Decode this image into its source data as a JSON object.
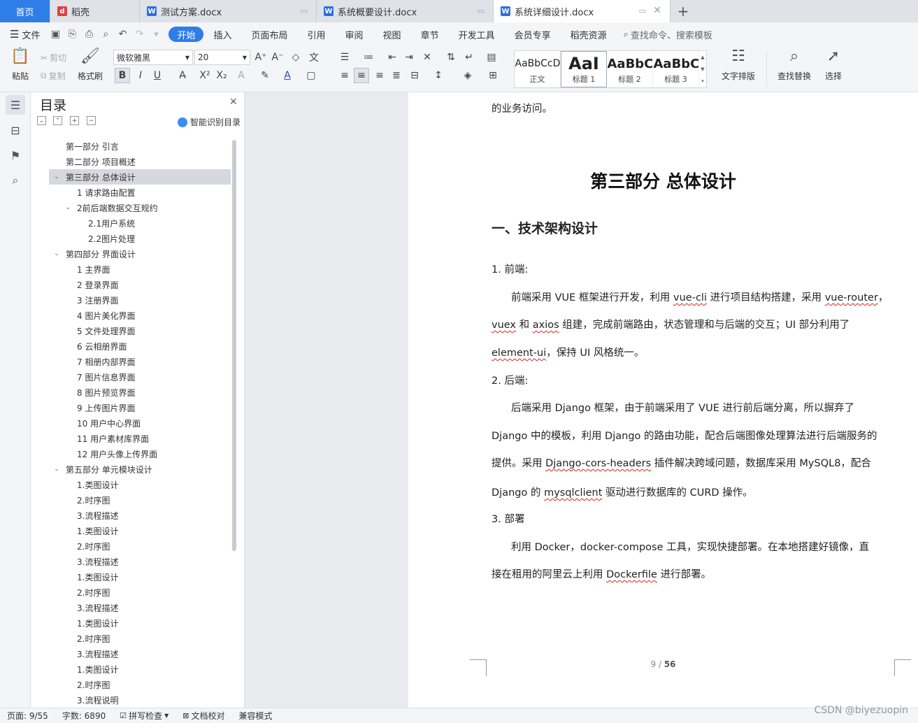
{
  "tabs": [
    {
      "label": "首页",
      "kind": "home"
    },
    {
      "label": "稻壳",
      "kind": "docer"
    },
    {
      "label": "测试方案.docx",
      "kind": "file"
    },
    {
      "label": "系统概要设计.docx",
      "kind": "file"
    },
    {
      "label": "系统详细设计.docx",
      "kind": "active"
    }
  ],
  "menu": {
    "file": "文件",
    "items": [
      "开始",
      "插入",
      "页面布局",
      "引用",
      "审阅",
      "视图",
      "章节",
      "开发工具",
      "会员专享",
      "稻壳资源"
    ],
    "search": "查找命令、搜索模板"
  },
  "ribbon": {
    "paste": "粘贴",
    "cut": "剪切",
    "copy": "复制",
    "format_painter": "格式刷",
    "font_name": "微软雅黑",
    "font_size": "20",
    "styles": [
      {
        "preview": "AaBbCcDd",
        "label": "正文"
      },
      {
        "preview": "AaI",
        "label": "标题 1"
      },
      {
        "preview": "AaBbC",
        "label": "标题 2"
      },
      {
        "preview": "AaBbC",
        "label": "标题 3"
      }
    ],
    "text_layout": "文字排版",
    "find_replace": "查找替换",
    "select": "选择"
  },
  "toc": {
    "title": "目录",
    "smart": "智能识别目录",
    "items": [
      {
        "text": "第一部分 引言",
        "level": 1,
        "arrow": ""
      },
      {
        "text": "第二部分 项目概述",
        "level": 1,
        "arrow": ""
      },
      {
        "text": "第三部分 总体设计",
        "level": 1,
        "arrow": "v",
        "selected": true
      },
      {
        "text": "1 请求路由配置",
        "level": 2,
        "arrow": ""
      },
      {
        "text": "2前后端数据交互规约",
        "level": 2,
        "arrow": "v"
      },
      {
        "text": "2.1用户系统",
        "level": 3,
        "arrow": ""
      },
      {
        "text": "2.2图片处理",
        "level": 3,
        "arrow": ""
      },
      {
        "text": "第四部分 界面设计",
        "level": 1,
        "arrow": "v"
      },
      {
        "text": "1 主界面",
        "level": 2,
        "arrow": ""
      },
      {
        "text": "2 登录界面",
        "level": 2,
        "arrow": ""
      },
      {
        "text": "3 注册界面",
        "level": 2,
        "arrow": ""
      },
      {
        "text": "4 图片美化界面",
        "level": 2,
        "arrow": ""
      },
      {
        "text": "5 文件处理界面",
        "level": 2,
        "arrow": ""
      },
      {
        "text": "6 云相册界面",
        "level": 2,
        "arrow": ""
      },
      {
        "text": "7 相册内部界面",
        "level": 2,
        "arrow": ""
      },
      {
        "text": "7 图片信息界面",
        "level": 2,
        "arrow": ""
      },
      {
        "text": "8 图片预览界面",
        "level": 2,
        "arrow": ""
      },
      {
        "text": "9 上传图片界面",
        "level": 2,
        "arrow": ""
      },
      {
        "text": "10 用户中心界面",
        "level": 2,
        "arrow": ""
      },
      {
        "text": "11 用户素材库界面",
        "level": 2,
        "arrow": ""
      },
      {
        "text": "12 用户头像上传界面",
        "level": 2,
        "arrow": ""
      },
      {
        "text": "第五部分 单元模块设计",
        "level": 1,
        "arrow": "v"
      },
      {
        "text": "1.类图设计",
        "level": 2,
        "arrow": ""
      },
      {
        "text": "2.时序图",
        "level": 2,
        "arrow": ""
      },
      {
        "text": "3.流程描述",
        "level": 2,
        "arrow": ""
      },
      {
        "text": "1.类图设计",
        "level": 2,
        "arrow": ""
      },
      {
        "text": "2.时序图",
        "level": 2,
        "arrow": ""
      },
      {
        "text": "3.流程描述",
        "level": 2,
        "arrow": ""
      },
      {
        "text": "1.类图设计",
        "level": 2,
        "arrow": ""
      },
      {
        "text": "2.时序图",
        "level": 2,
        "arrow": ""
      },
      {
        "text": "3.流程描述",
        "level": 2,
        "arrow": ""
      },
      {
        "text": "1.类图设计",
        "level": 2,
        "arrow": ""
      },
      {
        "text": "2.时序图",
        "level": 2,
        "arrow": ""
      },
      {
        "text": "3.流程描述",
        "level": 2,
        "arrow": ""
      },
      {
        "text": "1.类图设计",
        "level": 2,
        "arrow": ""
      },
      {
        "text": "2.时序图",
        "level": 2,
        "arrow": ""
      },
      {
        "text": "3.流程说明",
        "level": 2,
        "arrow": ""
      }
    ]
  },
  "document": {
    "prev_tail": "的业务访问。",
    "heading": "第三部分 总体设计",
    "subheading": "一、技术架构设计",
    "s1": "1. 前端:",
    "p1_l1a": "前端采用 VUE 框架进行开发，利用 ",
    "p1_l1b": "vue-cli",
    "p1_l1c": " 进行项目结构搭建，采用 ",
    "p1_l1d": "vue-router",
    "p1_l1e": "，",
    "p1_l2a": "vuex",
    "p1_l2b": " 和 ",
    "p1_l2c": "axios",
    "p1_l2d": " 组建，完成前端路由，状态管理和与后端的交互；UI 部分利用了",
    "p1_l3a": "element-ui",
    "p1_l3b": "，保持 UI 风格统一。",
    "s2": "2. 后端:",
    "p2_l1": "后端采用 Django 框架，由于前端采用了 VUE 进行前后端分离，所以摒弃了",
    "p2_l2": "Django 中的模板，利用 Django 的路由功能，配合后端图像处理算法进行后端服务的",
    "p2_l3a": "提供。采用 ",
    "p2_l3b": "Django-cors-headers",
    "p2_l3c": " 插件解决跨域问题，数据库采用 MySQL8，配合",
    "p2_l4a": "Django 的 ",
    "p2_l4b": "mysqlclient",
    "p2_l4c": " 驱动进行数据库的 CURD 操作。",
    "s3": "3. 部署",
    "p3_l1": "利用 Docker，docker-compose 工具，实现快捷部署。在本地搭建好镜像，直",
    "p3_l2a": "接在租用的阿里云上利用 ",
    "p3_l2b": "Dockerfile",
    "p3_l2c": " 进行部署。",
    "page_current": "9",
    "page_sep": " / ",
    "page_total": "56"
  },
  "status": {
    "page": "页面: 9/55",
    "words": "字数: 6890",
    "spell": "拼写检查",
    "proof": "文档校对",
    "compat": "兼容模式"
  },
  "watermark": "CSDN @biyezuopin"
}
